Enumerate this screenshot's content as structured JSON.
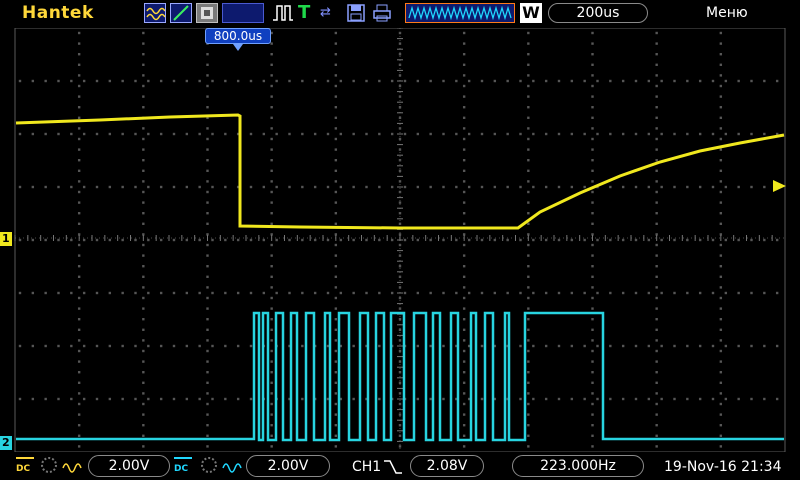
{
  "topbar": {
    "brand": "Hantek",
    "icons": [
      "waveform-icon",
      "trigger-slope-icon",
      "display-mode-icon",
      "pulse-icon",
      "trigger-t-icon",
      "arrows-icon",
      "save-icon",
      "print-icon"
    ],
    "w_label": "W",
    "timebase": "200us",
    "menu": "Меню"
  },
  "screen": {
    "trigger_time_marker": "800.0us",
    "ch1_marker": "1",
    "ch2_marker": "2"
  },
  "bottombar": {
    "ch1_coupling": "DC",
    "ch1_volts": "2.00V",
    "ch2_coupling": "DC",
    "ch2_volts": "2.00V",
    "trigger_source": "CH1",
    "trigger_level": "2.08V",
    "frequency": "223.000Hz",
    "datetime": "19-Nov-16 21:34"
  },
  "colors": {
    "ch1": "#f0e81e",
    "ch2": "#28d4e0",
    "grid": "#6a6a6a",
    "accent": "#1040c0"
  }
}
